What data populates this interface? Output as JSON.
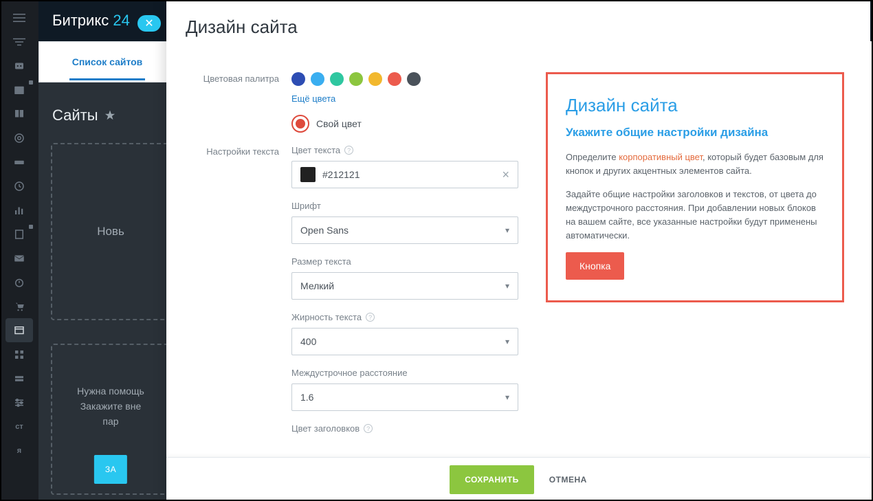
{
  "brand": {
    "name": "Битрикс",
    "num": "24"
  },
  "bg": {
    "tab": "Список сайтов",
    "sitesTitle": "Сайты",
    "newCard": "Новь",
    "helpTitle": "Нужна помощь",
    "helpText": "Закажите вне",
    "helpText2": "пар",
    "helpBtn": "ЗА"
  },
  "modal": {
    "title": "Дизайн сайта",
    "labels": {
      "palette": "Цветовая палитра",
      "moreColors": "Ещё цвета",
      "ownColor": "Свой цвет",
      "textSettings": "Настройки текста",
      "textColor": "Цвет текста",
      "font": "Шрифт",
      "textSize": "Размер текста",
      "weight": "Жирность текста",
      "lineHeight": "Междустрочное расстояние",
      "headingColor": "Цвет заголовков"
    },
    "values": {
      "textColor": "#212121",
      "font": "Open Sans",
      "textSize": "Мелкий",
      "weight": "400",
      "lineHeight": "1.6"
    },
    "swatches": [
      "#2d4db3",
      "#3aaef0",
      "#2fc7a0",
      "#8cc63f",
      "#f2b82e",
      "#ec5b4d",
      "#4a525a"
    ]
  },
  "preview": {
    "h1": "Дизайн сайта",
    "h2": "Укажите общие настройки дизайна",
    "p1a": "Определите ",
    "p1link": "корпоративный цвет",
    "p1b": ", который будет базовым для кнопок и других акцентных элементов сайта.",
    "p2": "Задайте общие настройки заголовков и текстов, от цвета до междустрочного расстояния. При добавлении новых блоков на вашем сайте, все указанные настройки будут применены автоматически.",
    "btn": "Кнопка"
  },
  "footer": {
    "save": "СОХРАНИТЬ",
    "cancel": "ОТМЕНА"
  },
  "rail_text": {
    "ct": "ст",
    "ya": "я"
  }
}
